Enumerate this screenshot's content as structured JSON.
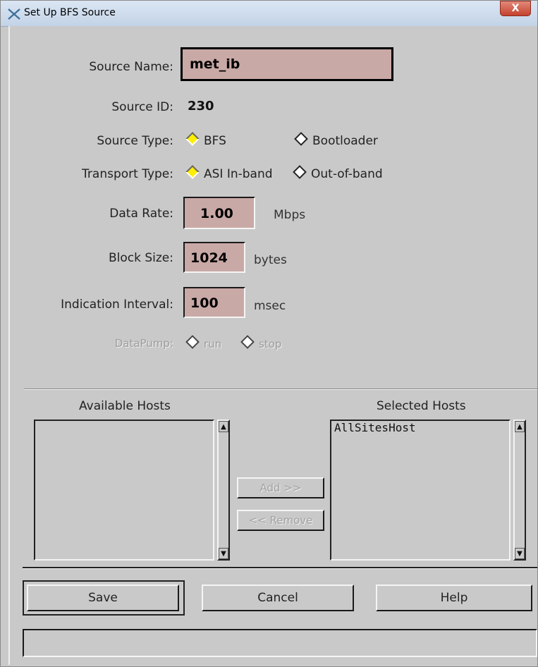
{
  "window": {
    "title": "Set Up BFS Source",
    "close_label": "X"
  },
  "form": {
    "source_name": {
      "label": "Source Name:",
      "value": "met_ib"
    },
    "source_id": {
      "label": "Source ID:",
      "value": "230"
    },
    "source_type": {
      "label": "Source Type:",
      "options": [
        "BFS",
        "Bootloader"
      ],
      "selected": "BFS"
    },
    "transport_type": {
      "label": "Transport Type:",
      "options": [
        "ASI In-band",
        "Out-of-band"
      ],
      "selected": "ASI In-band"
    },
    "data_rate": {
      "label": "Data Rate:",
      "value": "1.00",
      "unit": "Mbps"
    },
    "block_size": {
      "label": "Block Size:",
      "value": "1024",
      "unit": "bytes"
    },
    "indication_interval": {
      "label": "Indication Interval:",
      "value": "100",
      "unit": "msec"
    },
    "data_pump": {
      "label": "DataPump:",
      "options": [
        "run",
        "stop"
      ]
    }
  },
  "hosts": {
    "available_title": "Available Hosts",
    "selected_title": "Selected Hosts",
    "available": [],
    "selected": [
      "AllSitesHost"
    ],
    "add_label": "Add >>",
    "remove_label": "<< Remove"
  },
  "buttons": {
    "save": "Save",
    "cancel": "Cancel",
    "help": "Help"
  },
  "colors": {
    "background": "#c9c9c9",
    "field": "#c9a9a6",
    "radio_selected": "#ffee00"
  },
  "icons": {
    "app": "x-cross-icon",
    "close": "close-icon",
    "scroll_up": "arrow-up-icon",
    "scroll_down": "arrow-down-icon"
  }
}
